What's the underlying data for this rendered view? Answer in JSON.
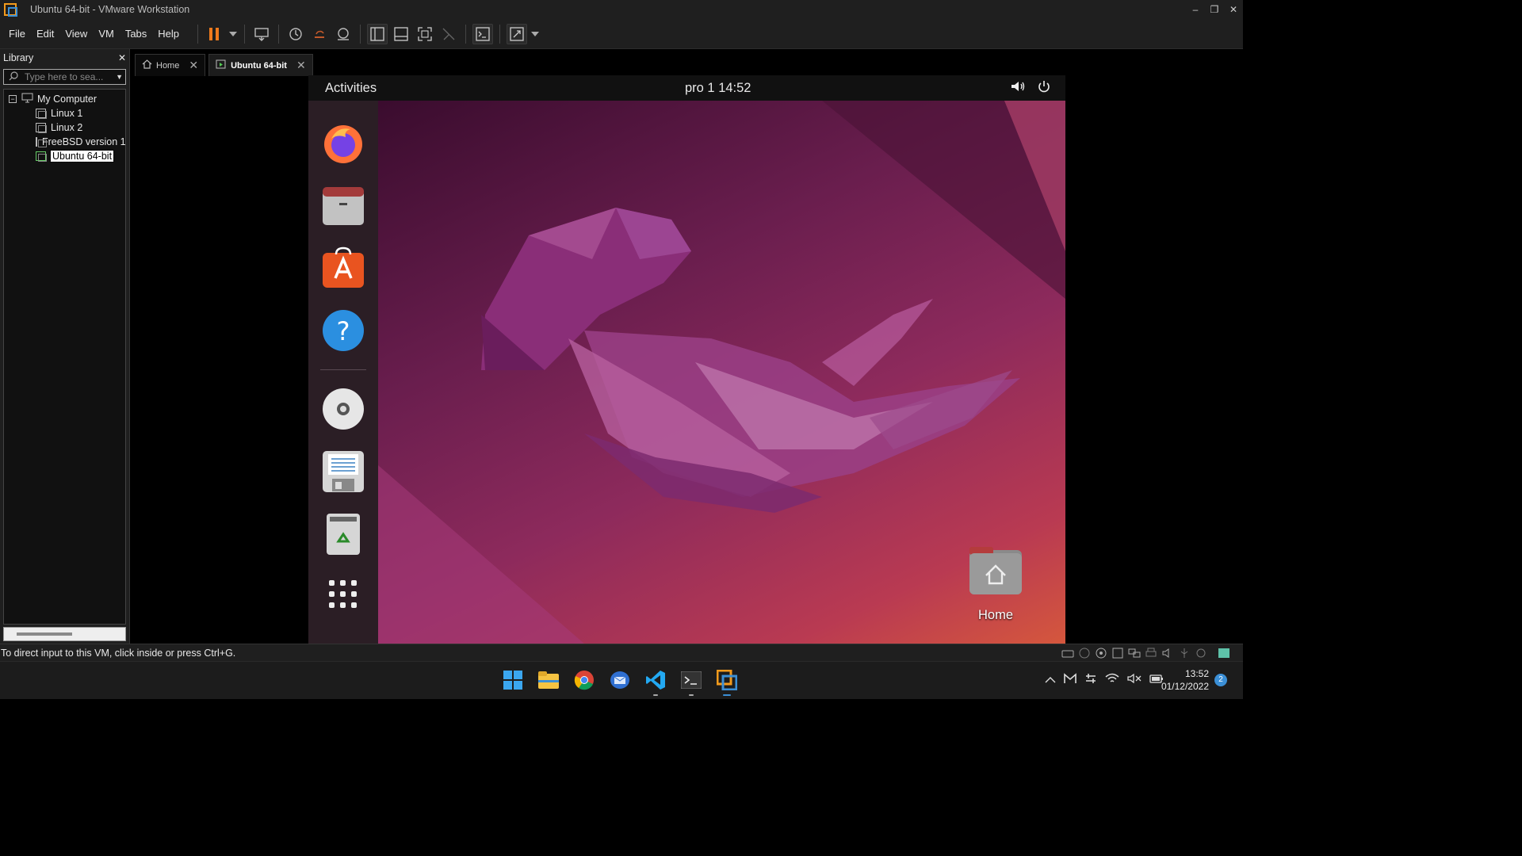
{
  "window": {
    "title": "Ubuntu 64-bit - VMware Workstation",
    "minimize": "–",
    "restore": "❐",
    "close": "✕"
  },
  "menu": [
    "File",
    "Edit",
    "View",
    "VM",
    "Tabs",
    "Help"
  ],
  "library": {
    "title": "Library",
    "close": "✕",
    "search_placeholder": "Type here to sea...",
    "root": "My Computer",
    "items": [
      "Linux 1",
      "Linux 2",
      "FreeBSD version 1",
      "Ubuntu 64-bit"
    ]
  },
  "tabs": [
    {
      "label": "Home",
      "close": "✕"
    },
    {
      "label": "Ubuntu 64-bit",
      "close": "✕"
    }
  ],
  "guest": {
    "activities": "Activities",
    "clock": "pro 1  14:52",
    "desktop_icon": "Home",
    "dock": [
      "firefox-icon",
      "files-icon",
      "software-icon",
      "help-icon",
      "cdrom-icon",
      "floppy-icon",
      "trash-icon",
      "app-grid-icon"
    ]
  },
  "status": {
    "message": "To direct input to this VM, click inside or press Ctrl+G."
  },
  "taskbar": {
    "time": "13:52",
    "date": "01/12/2022",
    "notifications": "2"
  }
}
